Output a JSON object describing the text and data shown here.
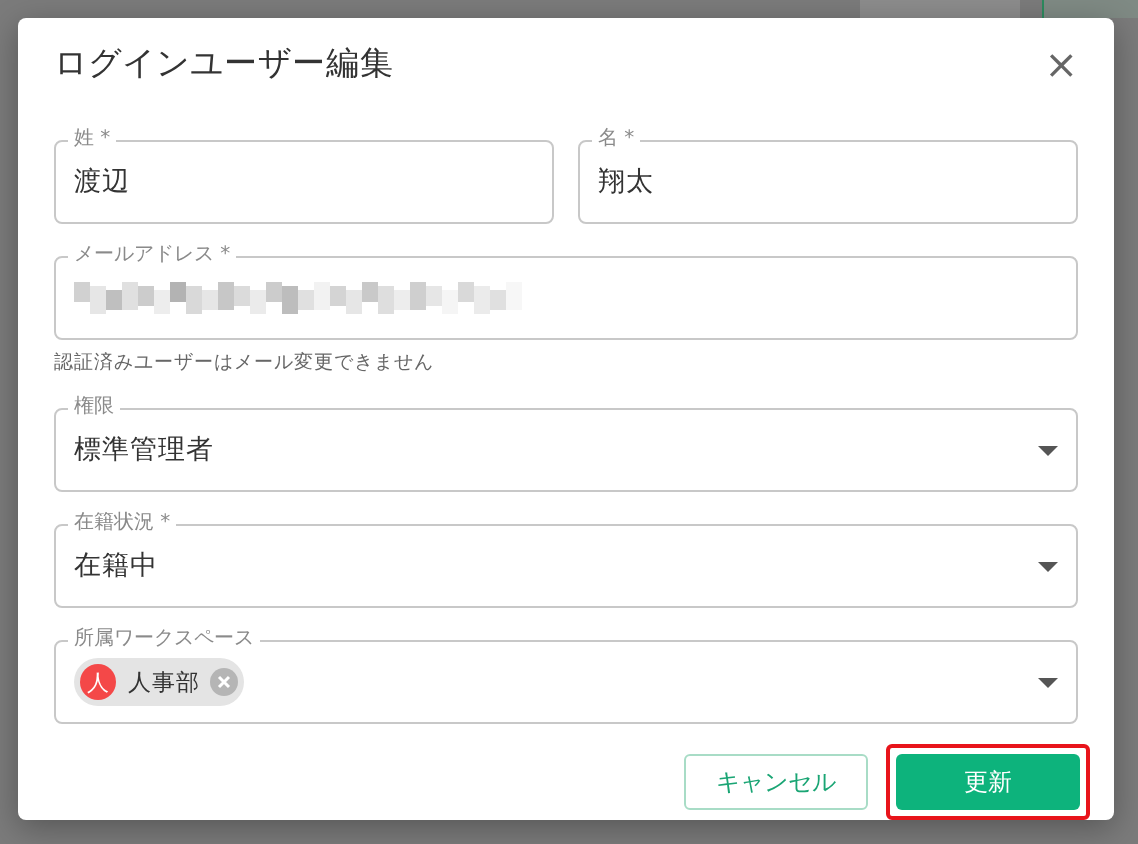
{
  "dialog": {
    "title": "ログインユーザー編集",
    "close_icon": "×",
    "rows": [
      [
        {
          "kind": "text",
          "label": "姓 *",
          "value": "渡辺"
        },
        {
          "kind": "text",
          "label": "名 *",
          "value": "翔太"
        }
      ],
      [
        {
          "kind": "redacted",
          "label": "メールアドレス *",
          "helper": "認証済みユーザーはメール変更できません"
        }
      ],
      [
        {
          "kind": "select",
          "label": "権限",
          "value": "標準管理者"
        }
      ],
      [
        {
          "kind": "select",
          "label": "在籍状況 *",
          "value": "在籍中"
        }
      ],
      [
        {
          "kind": "chips",
          "label": "所属ワークスペース",
          "chips": [
            {
              "avatar": "人",
              "label": "人事部",
              "color": "#f44848"
            }
          ]
        }
      ]
    ],
    "buttons": [
      {
        "kind": "outlined",
        "label": "キャンセル",
        "highlighted": false
      },
      {
        "kind": "primary",
        "label": "更新",
        "highlighted": true
      }
    ]
  }
}
